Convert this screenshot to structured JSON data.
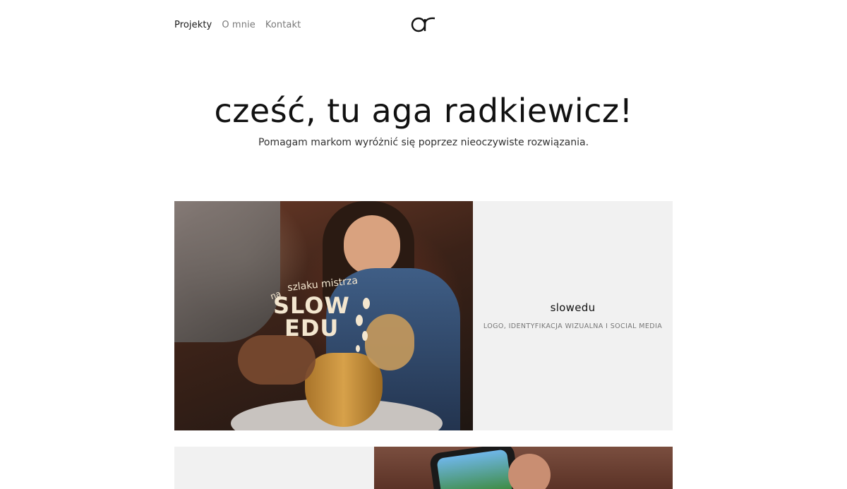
{
  "nav": {
    "items": [
      {
        "label": "Projekty",
        "active": true
      },
      {
        "label": "O mnie",
        "active": false
      },
      {
        "label": "Kontakt",
        "active": false
      }
    ]
  },
  "logo": {
    "text": "ar"
  },
  "hero": {
    "title": "cześć, tu aga radkiewicz!",
    "subtitle": "Pomagam markom wyróżnić się poprzez nieoczywiste rozwiązania."
  },
  "projects": [
    {
      "title": "slowedu",
      "tags": "LOGO, IDENTYFIKACJA WIZUALNA I SOCIAL MEDIA",
      "image_text": {
        "prefix": "na",
        "small": "szlaku mistrza",
        "line1": "SLOW",
        "line2": "EDU"
      }
    }
  ],
  "colors": {
    "background": "#ffffff",
    "card_bg": "#f1f1f1",
    "text_primary": "#111111",
    "text_secondary": "#777777",
    "brand_cream": "#f3e6cf"
  }
}
